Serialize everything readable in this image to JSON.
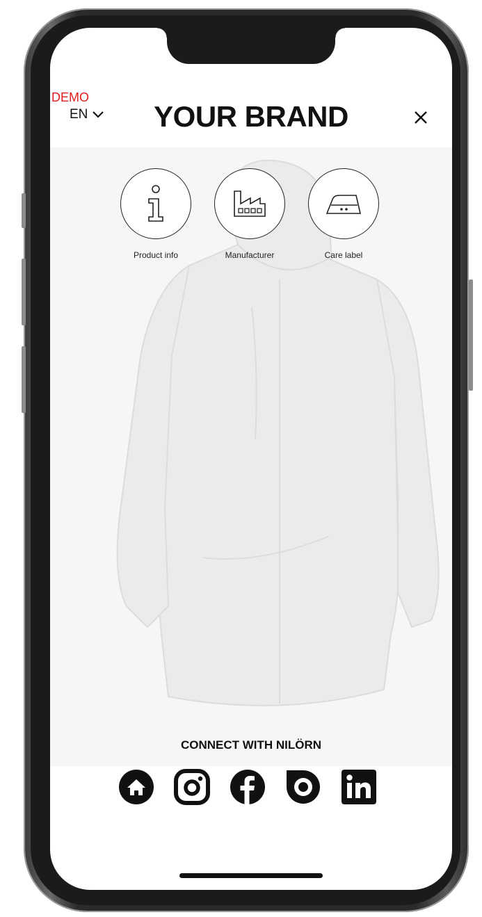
{
  "header": {
    "demo_label": "DEMO",
    "language": "EN",
    "brand_title": "YOUR BRAND"
  },
  "actions": [
    {
      "label": "Product info",
      "icon": "info-icon"
    },
    {
      "label": "Manufacturer",
      "icon": "factory-icon"
    },
    {
      "label": "Care label",
      "icon": "iron-icon"
    }
  ],
  "connect": {
    "title": "CONNECT WITH NILÖRN",
    "links": [
      "home-icon",
      "instagram-icon",
      "facebook-icon",
      "nilorn-icon",
      "linkedin-icon"
    ]
  },
  "colors": {
    "demo": "#e11d1d",
    "text": "#111111",
    "frame": "#1b1b1b"
  }
}
